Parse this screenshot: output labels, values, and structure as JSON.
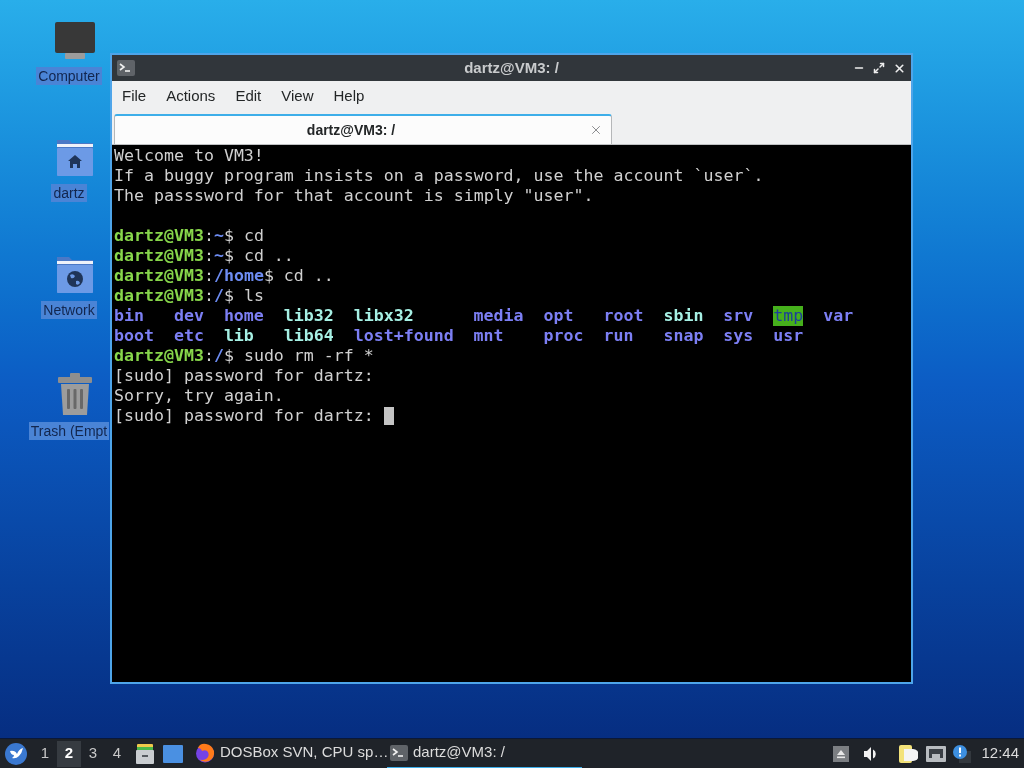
{
  "desktop_icons": [
    {
      "kind": "computer",
      "label": "Computer"
    },
    {
      "kind": "home",
      "label": "dartz"
    },
    {
      "kind": "network",
      "label": "Network"
    },
    {
      "kind": "trash",
      "label": "Trash (Empt"
    }
  ],
  "window": {
    "title": "dartz@VM3: /",
    "menu": [
      "File",
      "Actions",
      "Edit",
      "View",
      "Help"
    ],
    "tabs": [
      {
        "label": "dartz@VM3: /",
        "selected": true
      }
    ],
    "terminal": {
      "cursor": true,
      "lines": [
        {
          "kind": "output",
          "text": "Welcome to VM3!"
        },
        {
          "kind": "output",
          "text": "If a buggy program insists on a password, use the account `user`."
        },
        {
          "kind": "output",
          "text": "The passsword for that account is simply \"user\"."
        },
        {
          "kind": "blank"
        },
        {
          "kind": "prompt",
          "segments": [
            {
              "kind": "user",
              "text": "dartz@VM3"
            },
            {
              "kind": "plain",
              "text": ":"
            },
            {
              "kind": "path",
              "text": "~"
            },
            {
              "kind": "plain",
              "text": "$ cd"
            }
          ]
        },
        {
          "kind": "prompt",
          "segments": [
            {
              "kind": "user",
              "text": "dartz@VM3"
            },
            {
              "kind": "plain",
              "text": ":"
            },
            {
              "kind": "path",
              "text": "~"
            },
            {
              "kind": "plain",
              "text": "$ cd .."
            }
          ]
        },
        {
          "kind": "prompt",
          "segments": [
            {
              "kind": "user",
              "text": "dartz@VM3"
            },
            {
              "kind": "plain",
              "text": ":"
            },
            {
              "kind": "path",
              "text": "/home"
            },
            {
              "kind": "plain",
              "text": "$ cd .."
            }
          ]
        },
        {
          "kind": "prompt",
          "segments": [
            {
              "kind": "user",
              "text": "dartz@VM3"
            },
            {
              "kind": "plain",
              "text": ":"
            },
            {
              "kind": "path",
              "text": "/"
            },
            {
              "kind": "plain",
              "text": "$ ls"
            }
          ]
        },
        {
          "kind": "listing",
          "columns": [
            [
              {
                "kind": "dir",
                "name": "bin"
              },
              {
                "kind": "dir",
                "name": "boot"
              }
            ],
            [
              {
                "kind": "dir",
                "name": "dev"
              },
              {
                "kind": "dir",
                "name": "etc"
              }
            ],
            [
              {
                "kind": "dir",
                "name": "home"
              },
              {
                "kind": "link",
                "name": "lib"
              }
            ],
            [
              {
                "kind": "link",
                "name": "lib32"
              },
              {
                "kind": "link",
                "name": "lib64"
              }
            ],
            [
              {
                "kind": "link",
                "name": "libx32"
              },
              {
                "kind": "dir",
                "name": "lost+found"
              }
            ],
            [
              {
                "kind": "dir",
                "name": "media"
              },
              {
                "kind": "dir",
                "name": "mnt"
              }
            ],
            [
              {
                "kind": "dir",
                "name": "opt"
              },
              {
                "kind": "dir",
                "name": "proc"
              }
            ],
            [
              {
                "kind": "dir",
                "name": "root"
              },
              {
                "kind": "dir",
                "name": "run"
              }
            ],
            [
              {
                "kind": "link",
                "name": "sbin"
              },
              {
                "kind": "dir",
                "name": "snap"
              }
            ],
            [
              {
                "kind": "dir",
                "name": "srv"
              },
              {
                "kind": "dir",
                "name": "sys"
              }
            ],
            [
              {
                "kind": "sticky",
                "name": "tmp"
              },
              {
                "kind": "dir",
                "name": "usr"
              }
            ],
            [
              {
                "kind": "dir",
                "name": "var"
              }
            ]
          ]
        },
        {
          "kind": "prompt",
          "segments": [
            {
              "kind": "user",
              "text": "dartz@VM3"
            },
            {
              "kind": "plain",
              "text": ":"
            },
            {
              "kind": "path",
              "text": "/"
            },
            {
              "kind": "plain",
              "text": "$ sudo rm -rf *"
            }
          ]
        },
        {
          "kind": "output",
          "text": "[sudo] password for dartz:"
        },
        {
          "kind": "output",
          "text": "Sorry, try again."
        },
        {
          "kind": "output",
          "text": "[sudo] password for dartz:"
        }
      ]
    }
  },
  "taskbar": {
    "workspaces": [
      {
        "label": "1",
        "selected": false
      },
      {
        "label": "2",
        "selected": true
      },
      {
        "label": "3",
        "selected": false
      },
      {
        "label": "4",
        "selected": false
      }
    ],
    "tasks": [
      {
        "kind": "browser",
        "label": "DOSBox SVN, CPU sp…",
        "selected": false
      },
      {
        "kind": "terminal",
        "label": "dartz@VM3: /",
        "selected": true
      }
    ],
    "clock": "12:44"
  }
}
